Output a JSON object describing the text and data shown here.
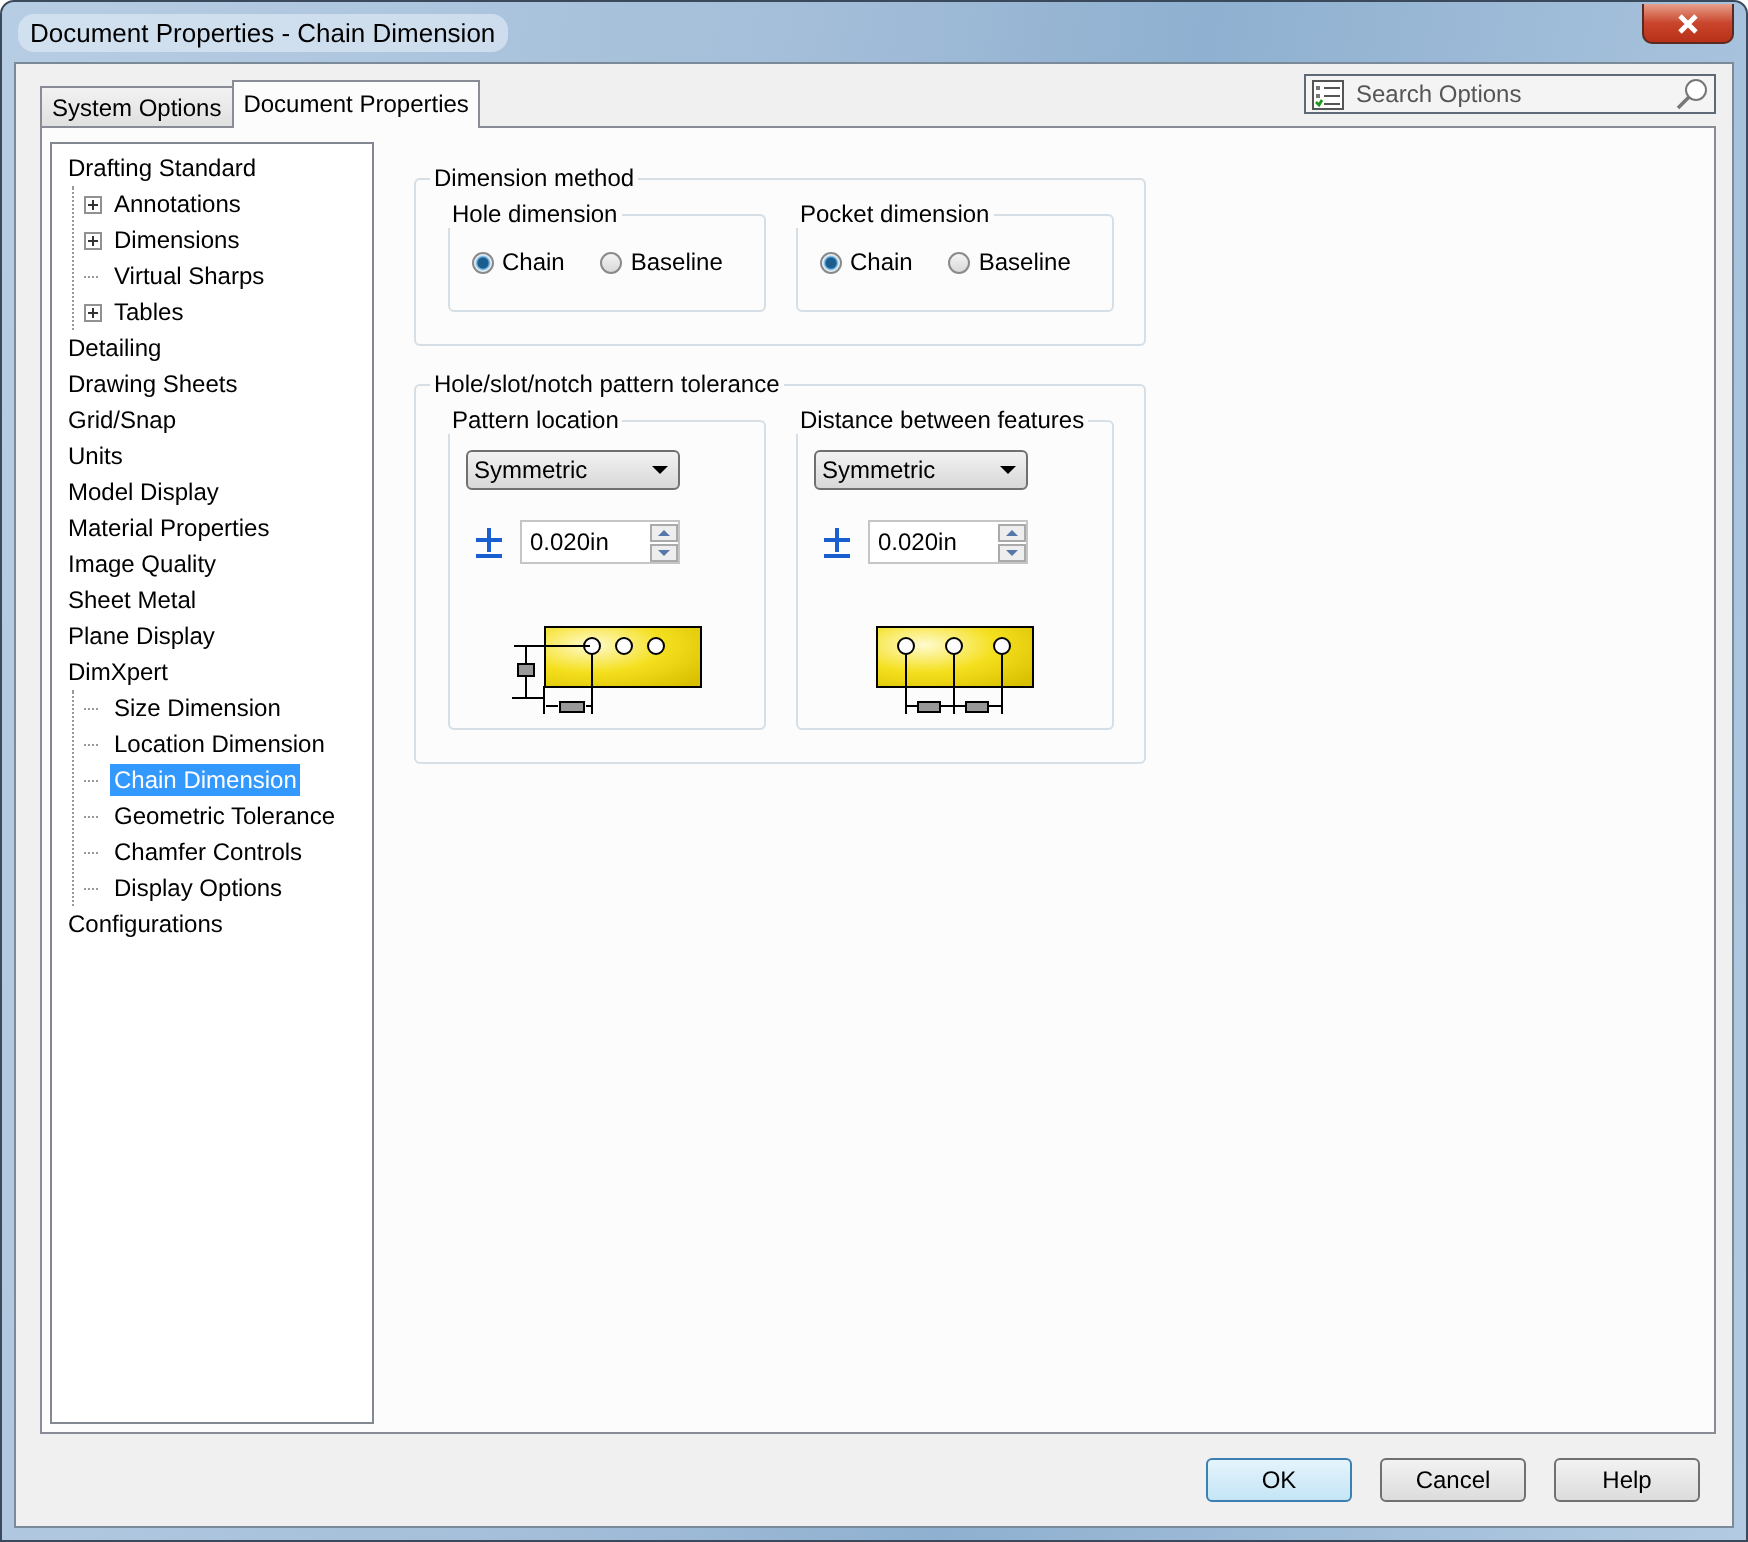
{
  "window": {
    "title": "Document Properties - Chain Dimension"
  },
  "tabs": [
    {
      "label": "System Options",
      "selected": false
    },
    {
      "label": "Document Properties",
      "selected": true
    }
  ],
  "search": {
    "placeholder": "Search Options"
  },
  "tree": [
    {
      "label": "Drafting Standard",
      "selected": false,
      "children": [
        {
          "label": "Annotations",
          "selected": false,
          "expanded": false
        },
        {
          "label": "Dimensions",
          "selected": false,
          "expanded": false
        },
        {
          "label": "Virtual Sharps",
          "selected": false
        },
        {
          "label": "Tables",
          "selected": false,
          "expanded": false
        }
      ]
    },
    {
      "label": "Detailing",
      "selected": false
    },
    {
      "label": "Drawing Sheets",
      "selected": false
    },
    {
      "label": "Grid/Snap",
      "selected": false
    },
    {
      "label": "Units",
      "selected": false
    },
    {
      "label": "Model Display",
      "selected": false
    },
    {
      "label": "Material Properties",
      "selected": false
    },
    {
      "label": "Image Quality",
      "selected": false
    },
    {
      "label": "Sheet Metal",
      "selected": false
    },
    {
      "label": "Plane Display",
      "selected": false
    },
    {
      "label": "DimXpert",
      "selected": false,
      "children": [
        {
          "label": "Size Dimension",
          "selected": false
        },
        {
          "label": "Location Dimension",
          "selected": false
        },
        {
          "label": "Chain Dimension",
          "selected": true
        },
        {
          "label": "Geometric Tolerance",
          "selected": false
        },
        {
          "label": "Chamfer Controls",
          "selected": false
        },
        {
          "label": "Display Options",
          "selected": false
        }
      ]
    },
    {
      "label": "Configurations",
      "selected": false
    }
  ],
  "dimension_method": {
    "title": "Dimension method",
    "groups": [
      {
        "title": "Hole dimension",
        "options": [
          {
            "label": "Chain",
            "selected": true
          },
          {
            "label": "Baseline",
            "selected": false
          }
        ]
      },
      {
        "title": "Pocket dimension",
        "options": [
          {
            "label": "Chain",
            "selected": true
          },
          {
            "label": "Baseline",
            "selected": false
          }
        ]
      }
    ]
  },
  "pattern_tolerance": {
    "title": "Hole/slot/notch pattern tolerance",
    "groups": [
      {
        "title": "Pattern location",
        "dropdown": "Symmetric",
        "value": "0.020in",
        "diagram": {
          "kind": "location"
        }
      },
      {
        "title": "Distance between features",
        "dropdown": "Symmetric",
        "value": "0.020in",
        "diagram": {
          "kind": "distance"
        }
      }
    ]
  },
  "buttons": [
    {
      "label": "OK",
      "default": true
    },
    {
      "label": "Cancel",
      "default": false
    },
    {
      "label": "Help",
      "default": false
    }
  ]
}
